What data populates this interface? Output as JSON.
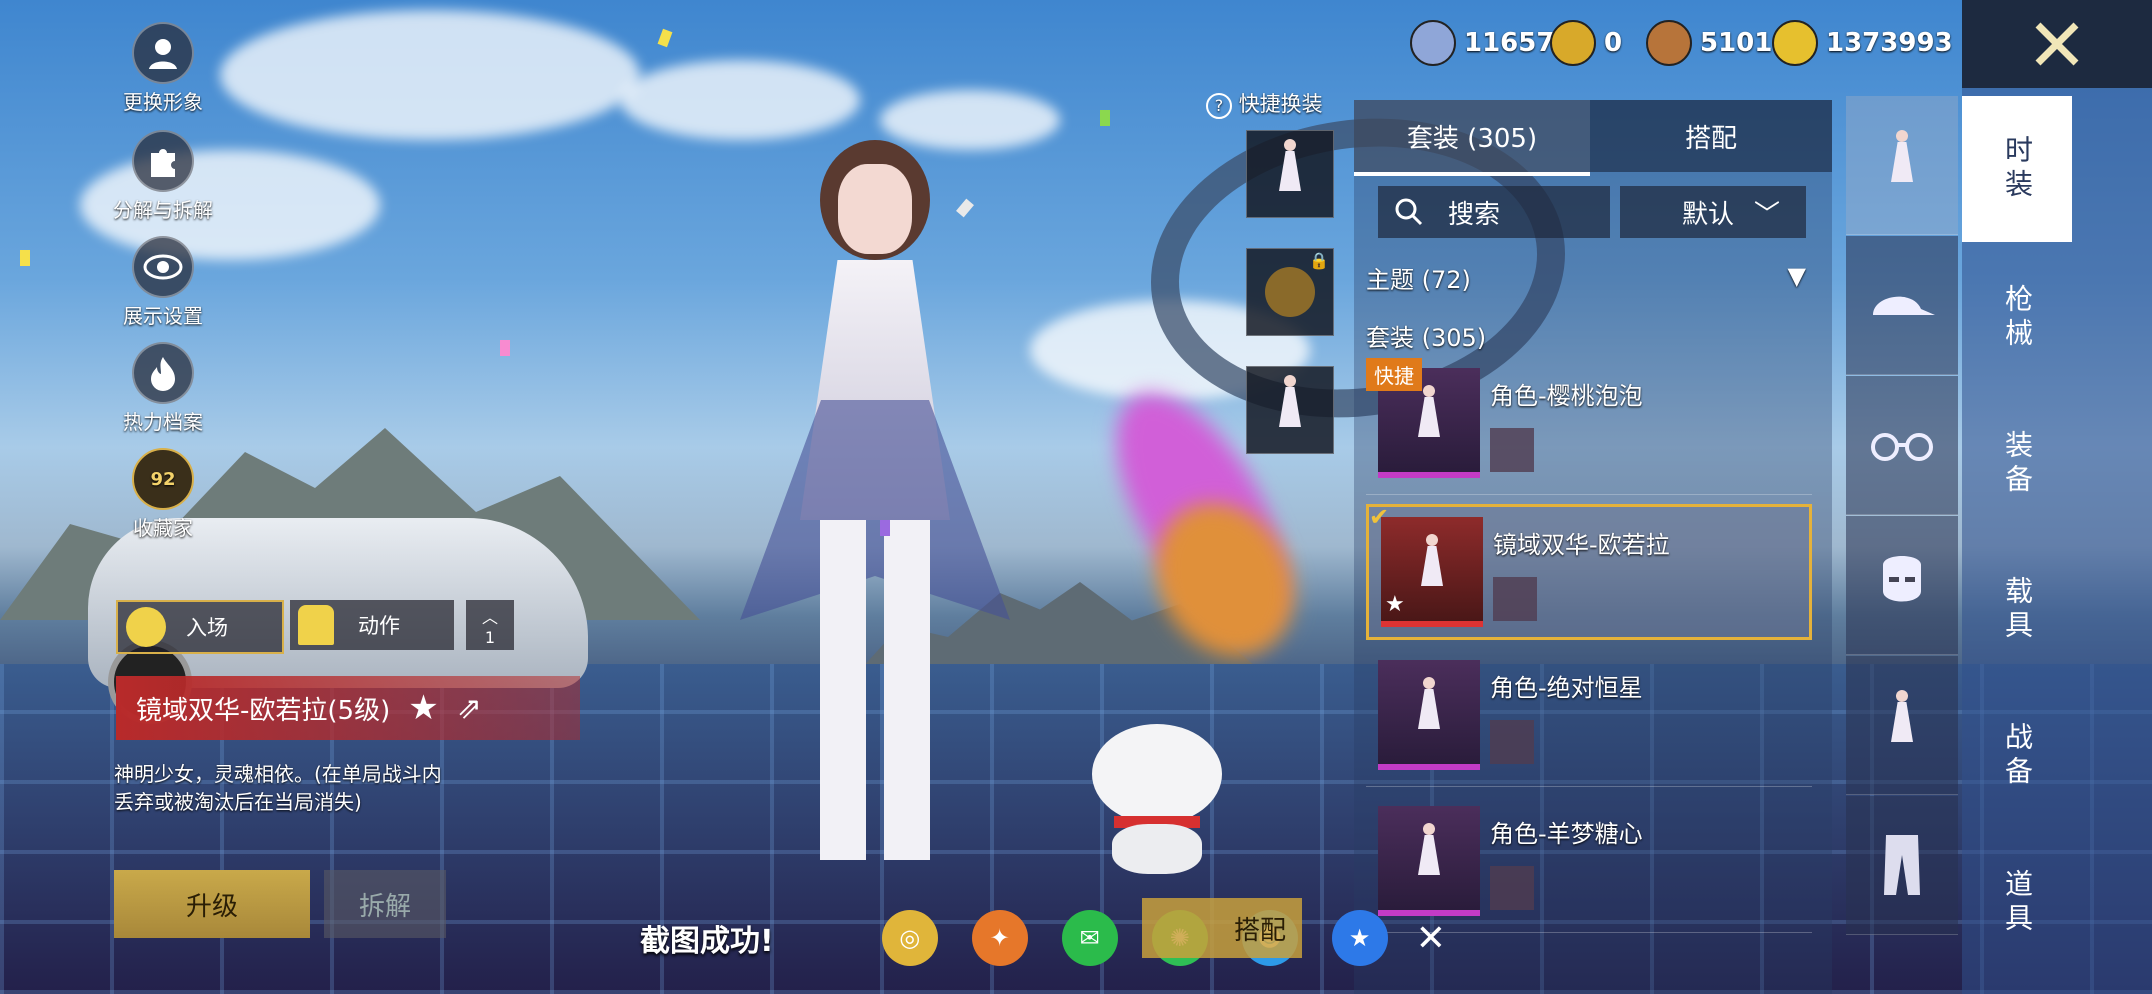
{
  "currencies": [
    {
      "icon": "silver-token-icon",
      "value": "116571",
      "color": "#8fa6d8"
    },
    {
      "icon": "gold-a-token-icon",
      "value": "0",
      "color": "#d8a92a"
    },
    {
      "icon": "bronze-coin-icon",
      "value": "5101",
      "color": "#b7743a"
    },
    {
      "icon": "gold-coin-icon",
      "value": "1373993",
      "color": "#e6c02e"
    }
  ],
  "left_menu": [
    {
      "icon": "avatar-icon",
      "label": "更换形象"
    },
    {
      "icon": "puzzle-icon",
      "label": "分解与拆解"
    },
    {
      "icon": "eye-icon",
      "label": "展示设置"
    },
    {
      "icon": "flame-icon",
      "label": "热力档案"
    },
    {
      "icon": "collector-badge-icon",
      "label": "收藏家",
      "badge": "92"
    }
  ],
  "actions": {
    "entry_label": "入场",
    "motion_label": "动作",
    "expand_label": "1"
  },
  "selected_outfit": {
    "name": "镜域双华-欧若拉(5级)",
    "description": "神明少女，灵魂相依。(在单局战斗内丢弃或被淘汰后在当局消失)",
    "upgrade_label": "升级",
    "dismantle_label": "拆解"
  },
  "quick_change": {
    "label": "快捷换装",
    "help_icon": "?"
  },
  "tabs": [
    {
      "label": "套装 (305)",
      "active": true
    },
    {
      "label": "搭配",
      "active": false
    }
  ],
  "search": {
    "label": "搜索",
    "sort_label": "默认"
  },
  "sections": {
    "theme": "主题 (72)",
    "suits": "套装 (305)"
  },
  "items": [
    {
      "name": "角色-樱桃泡泡",
      "tag": "快捷"
    },
    {
      "name": "镜域双华-欧若拉",
      "selected": true
    },
    {
      "name": "角色-绝对恒星"
    },
    {
      "name": "角色-羊梦糖心"
    }
  ],
  "categories": [
    {
      "label": "时装",
      "active": true
    },
    {
      "label": "枪械"
    },
    {
      "label": "装备"
    },
    {
      "label": "载具"
    },
    {
      "label": "战备"
    },
    {
      "label": "道具"
    }
  ],
  "side_icons": [
    "outfit-icon",
    "cap-icon",
    "glasses-icon",
    "mask-icon",
    "outfit-icon",
    "pants-icon"
  ],
  "screenshot_bar": {
    "message": "截图成功!",
    "apps": [
      "camera-icon",
      "game-logo-icon",
      "wechat-icon",
      "moments-icon",
      "qq-icon",
      "qzone-icon"
    ],
    "partial_button": "搭配"
  }
}
